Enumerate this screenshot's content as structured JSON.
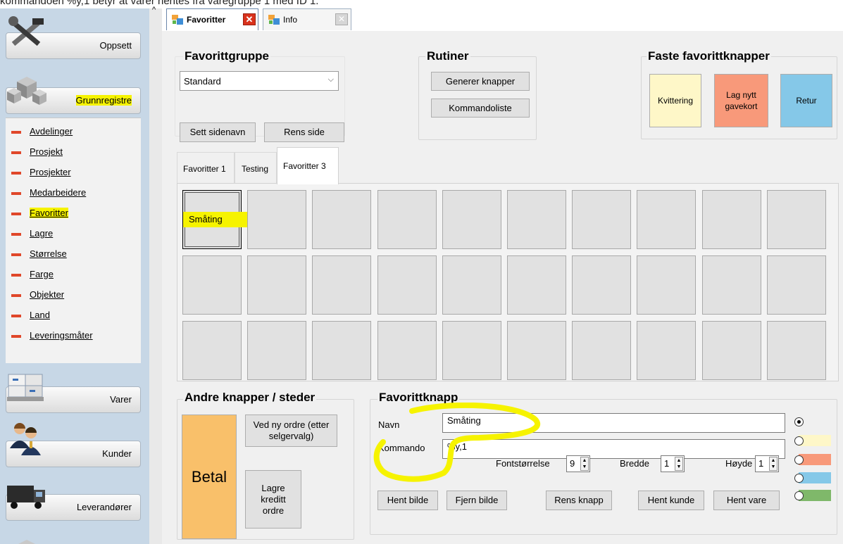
{
  "top_note": "kommandoen %y,1 betyr at varer hentes fra varegruppe 1 med ID 1.",
  "sidebar": {
    "categories": [
      {
        "label": "Oppsett",
        "icon": "tools-icon"
      },
      {
        "label": "Grunnregistre",
        "icon": "cubes-icon"
      },
      {
        "label": "Varer",
        "icon": "pallet-icon"
      },
      {
        "label": "Kunder",
        "icon": "people-icon"
      },
      {
        "label": "Leverandører",
        "icon": "truck-icon"
      }
    ],
    "items": [
      "Avdelinger",
      "Prosjekt",
      "Prosjekter",
      "Medarbeidere",
      "Favoritter",
      "Lagre",
      "Størrelse",
      "Farge",
      "Objekter",
      "Land",
      "Leveringsmåter"
    ]
  },
  "tabs": [
    {
      "label": "Favoritter",
      "active": true
    },
    {
      "label": "Info",
      "active": false
    }
  ],
  "favorittgruppe": {
    "title": "Favorittgruppe",
    "selected": "Standard"
  },
  "rutiner": {
    "title": "Rutiner",
    "btn_generer": "Generer knapper",
    "btn_kommandoliste": "Kommandoliste"
  },
  "faste": {
    "title": "Faste favorittknapper",
    "kvittering": "Kvittering",
    "lag_nytt": "Lag nytt gavekort",
    "retur": "Retur"
  },
  "page_buttons": {
    "sett_sidenavn": "Sett sidenavn",
    "rens_side": "Rens side"
  },
  "page_tabs": [
    "Favoritter 1",
    "Testing",
    "Favoritter 3"
  ],
  "grid": {
    "rows": 3,
    "cols": 10,
    "first_label": "Småting"
  },
  "andre": {
    "title": "Andre knapper / steder",
    "betal": "Betal",
    "ved_ny_ordre": "Ved ny ordre (etter selgervalg)",
    "lagre_kreditt": "Lagre kreditt ordre"
  },
  "favorittknapp": {
    "title": "Favorittknapp",
    "navn_label": "Navn",
    "navn_value": "Småting",
    "kommando_label": "Kommando",
    "kommando_value": "%y,1",
    "fontstorrelse_label": "Fontstørrelse",
    "fontstorrelse_value": "9",
    "bredde_label": "Bredde",
    "bredde_value": "1",
    "hoyde_label": "Høyde",
    "hoyde_value": "1",
    "buttons": [
      "Hent bilde",
      "Fjern bilde",
      "Rens knapp",
      "Hent kunde",
      "Hent vare"
    ]
  },
  "colors": {
    "kvittering": "#fef7c8",
    "lag_nytt": "#f8997a",
    "retur": "#85c8e8",
    "betal": "#f9c06a",
    "highlight": "#f6f300",
    "swatch_green": "#7fb86a"
  }
}
